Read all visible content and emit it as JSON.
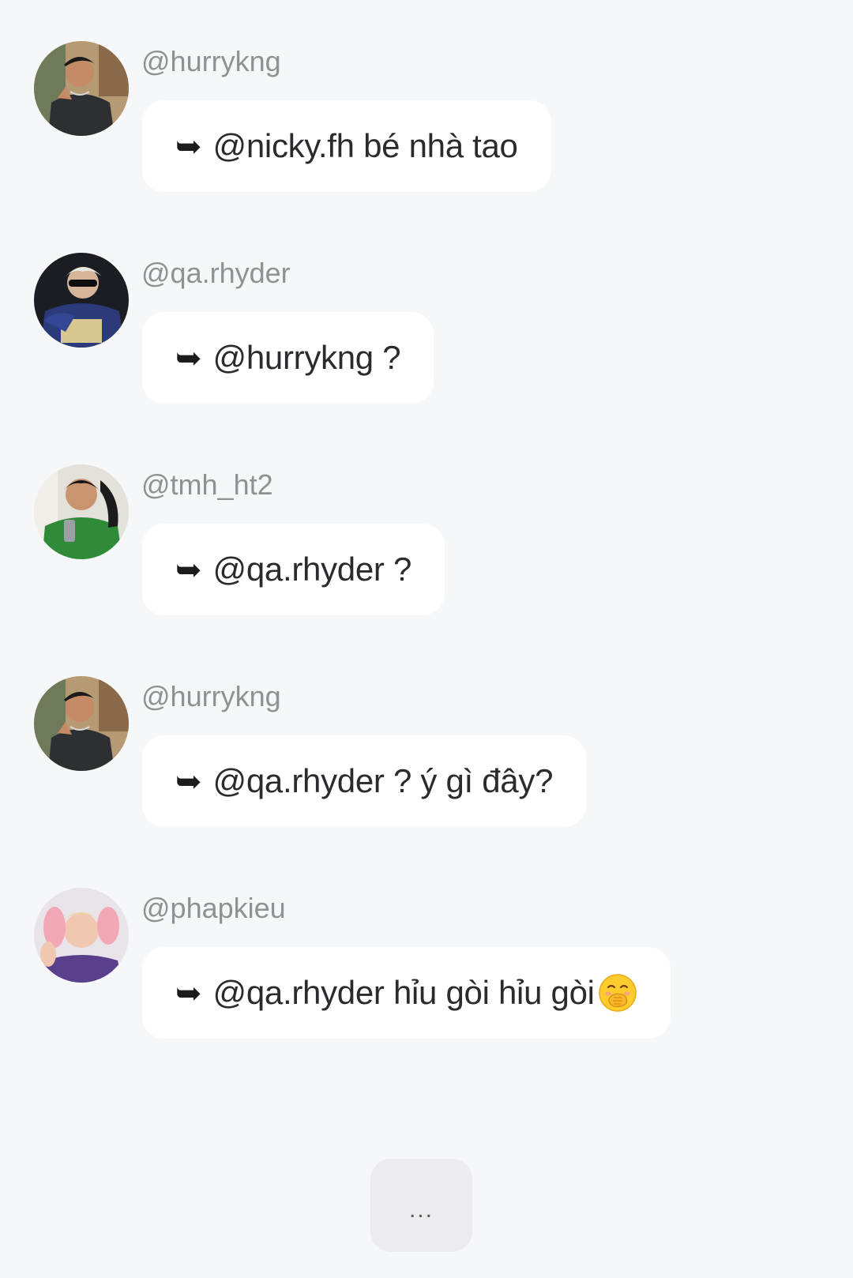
{
  "comments": [
    {
      "username": "@hurrykng",
      "reply_icon": "➥",
      "text": "@nicky.fh bé nhà tao",
      "avatar": "avatar-hurrykng"
    },
    {
      "username": "@qa.rhyder",
      "reply_icon": "➥",
      "text": "@hurrykng ?",
      "avatar": "avatar-qa-rhyder"
    },
    {
      "username": "@tmh_ht2",
      "reply_icon": "➥",
      "text": "@qa.rhyder ?",
      "avatar": "avatar-tmh-ht2"
    },
    {
      "username": "@hurrykng",
      "reply_icon": "➥",
      "text": "@qa.rhyder ? ý gì đây?",
      "avatar": "avatar-hurrykng"
    },
    {
      "username": "@phapkieu",
      "reply_icon": "➥",
      "text": "@qa.rhyder hỉu gòi hỉu gòi",
      "emoji": "face-with-hand-over-mouth-icon",
      "avatar": "avatar-phapkieu"
    }
  ],
  "more_button": {
    "label": "..."
  },
  "colors": {
    "background": "#f6f7f9",
    "bubble": "#ffffff",
    "username": "#8f9196",
    "text": "#2a2b2e",
    "more_button_bg": "#ececee"
  }
}
